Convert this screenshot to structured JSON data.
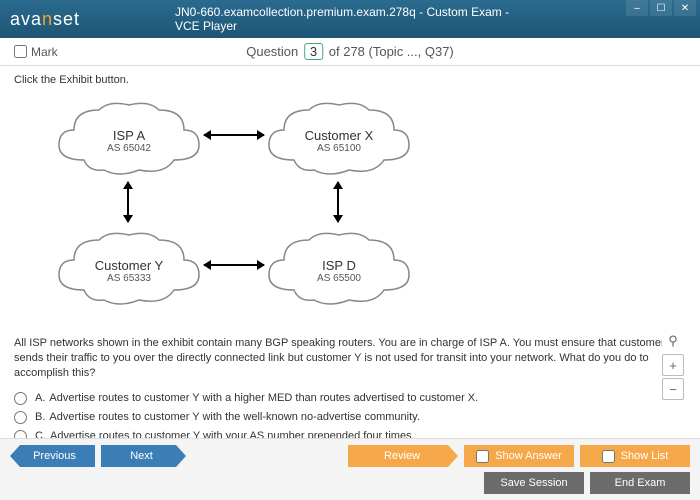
{
  "window": {
    "logo_pre": "ava",
    "logo_mid": "n",
    "logo_post": "set",
    "title": "JN0-660.examcollection.premium.exam.278q - Custom Exam - VCE Player",
    "min": "–",
    "max": "☐",
    "close": "✕"
  },
  "header": {
    "mark": "Mark",
    "q_label_pre": "Question",
    "q_num": "3",
    "q_label_post": "of 278 (Topic ..., Q37)"
  },
  "exhibit": {
    "instruction": "Click the Exhibit button.",
    "nodes": {
      "ispA": {
        "name": "ISP A",
        "as": "AS 65042"
      },
      "custX": {
        "name": "Customer X",
        "as": "AS 65100"
      },
      "custY": {
        "name": "Customer Y",
        "as": "AS 65333"
      },
      "ispD": {
        "name": "ISP D",
        "as": "AS 65500"
      }
    }
  },
  "question": "All ISP networks shown in the exhibit contain many BGP speaking routers. You are in charge of ISP A. You must ensure that customer Y sends their traffic to you over the directly connected link but customer Y is not used for transit into your network. What do you do to accomplish this?",
  "answers": [
    {
      "letter": "A.",
      "text": "Advertise routes to customer Y with a higher MED than routes advertised to customer X."
    },
    {
      "letter": "B.",
      "text": "Advertise routes to customer Y with the well-known no-advertise community."
    },
    {
      "letter": "C.",
      "text": "Advertise routes to customer Y with your AS number prepended four times."
    }
  ],
  "zoom": {
    "mag": "⚲",
    "plus": "+",
    "minus": "−"
  },
  "footer": {
    "previous": "Previous",
    "next": "Next",
    "review": "Review",
    "show_answer": "Show Answer",
    "show_list": "Show List",
    "save_session": "Save Session",
    "end_exam": "End Exam"
  }
}
